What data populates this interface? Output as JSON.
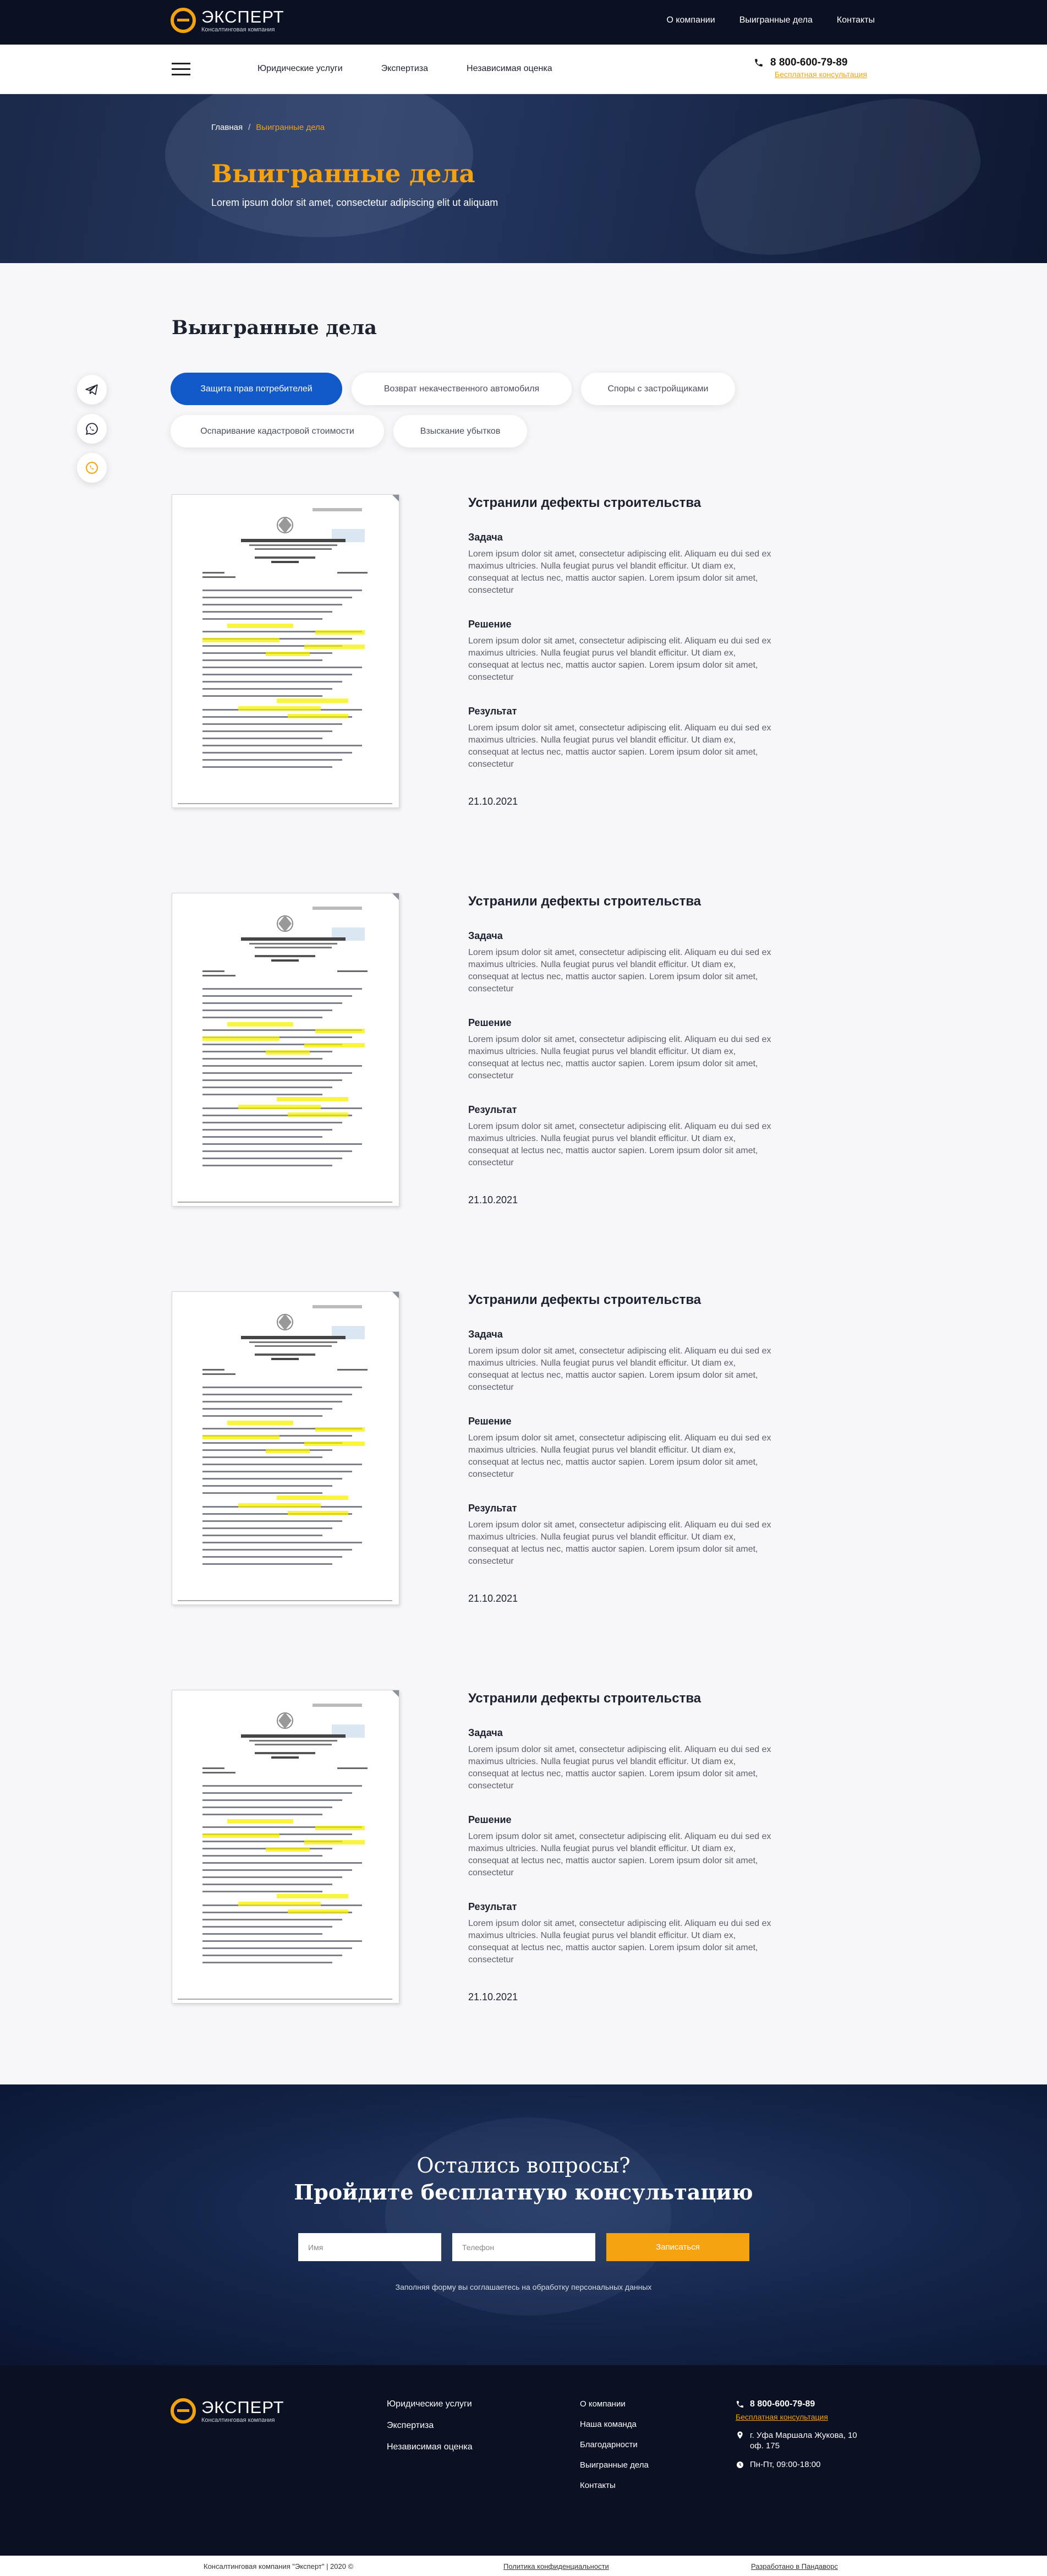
{
  "topbar": {
    "logo_title": "ЭКСПЕРТ",
    "logo_sub": "Консалтинговая компания",
    "nav": [
      "О компании",
      "Выигранные дела",
      "Контакты"
    ]
  },
  "navbar": {
    "menu": [
      "Юридические услуги",
      "Экспертиза",
      "Независимая оценка"
    ],
    "phone": "8 800-600-79-89",
    "consult": "Бесплатная консультация"
  },
  "hero": {
    "crumb_home": "Главная",
    "crumb_sep": "/",
    "crumb_current": "Выигранные дела",
    "title": "Выигранные дела",
    "subtitle": "Lorem ipsum dolor sit amet, consectetur adipiscing elit ut aliquam"
  },
  "section": {
    "title": "Выигранные дела",
    "tabs": [
      "Защита прав потребителей",
      "Возврат некачественного автомобиля",
      "Споры с застройщиками",
      "Оспаривание кадастровой стоимости",
      "Взыскание убытков"
    ],
    "active_tab": "Защита прав потребителей"
  },
  "social": [
    "telegram-icon",
    "whatsapp-icon",
    "viber-icon"
  ],
  "cases": [
    {
      "title": "Устранили дефекты строительства",
      "task_h": "Задача",
      "task": "Lorem ipsum dolor sit amet, consectetur adipiscing elit. Aliquam eu dui sed ex maximus ultricies. Nulla feugiat purus vel blandit efficitur. Ut diam ex, consequat at lectus nec, mattis auctor sapien. Lorem ipsum dolor sit amet, consectetur",
      "solution_h": "Решение",
      "solution": "Lorem ipsum dolor sit amet, consectetur adipiscing elit. Aliquam eu dui sed ex maximus ultricies. Nulla feugiat purus vel blandit efficitur. Ut diam ex, consequat at lectus nec, mattis auctor sapien. Lorem ipsum dolor sit amet, consectetur",
      "result_h": "Результат",
      "result": "Lorem ipsum dolor sit amet, consectetur adipiscing elit. Aliquam eu dui sed ex maximus ultricies. Nulla feugiat purus vel blandit efficitur. Ut diam ex, consequat at lectus nec, mattis auctor sapien. Lorem ipsum dolor sit amet, consectetur",
      "date": "21.10.2021"
    },
    {
      "title": "Устранили дефекты строительства",
      "task_h": "Задача",
      "task": "Lorem ipsum dolor sit amet, consectetur adipiscing elit. Aliquam eu dui sed ex maximus ultricies. Nulla feugiat purus vel blandit efficitur. Ut diam ex, consequat at lectus nec, mattis auctor sapien. Lorem ipsum dolor sit amet, consectetur",
      "solution_h": "Решение",
      "solution": "Lorem ipsum dolor sit amet, consectetur adipiscing elit. Aliquam eu dui sed ex maximus ultricies. Nulla feugiat purus vel blandit efficitur. Ut diam ex, consequat at lectus nec, mattis auctor sapien. Lorem ipsum dolor sit amet, consectetur",
      "result_h": "Результат",
      "result": "Lorem ipsum dolor sit amet, consectetur adipiscing elit. Aliquam eu dui sed ex maximus ultricies. Nulla feugiat purus vel blandit efficitur. Ut diam ex, consequat at lectus nec, mattis auctor sapien. Lorem ipsum dolor sit amet, consectetur",
      "date": "21.10.2021"
    },
    {
      "title": "Устранили дефекты строительства",
      "task_h": "Задача",
      "task": "Lorem ipsum dolor sit amet, consectetur adipiscing elit. Aliquam eu dui sed ex maximus ultricies. Nulla feugiat purus vel blandit efficitur. Ut diam ex, consequat at lectus nec, mattis auctor sapien. Lorem ipsum dolor sit amet, consectetur",
      "solution_h": "Решение",
      "solution": "Lorem ipsum dolor sit amet, consectetur adipiscing elit. Aliquam eu dui sed ex maximus ultricies. Nulla feugiat purus vel blandit efficitur. Ut diam ex, consequat at lectus nec, mattis auctor sapien. Lorem ipsum dolor sit amet, consectetur",
      "result_h": "Результат",
      "result": "Lorem ipsum dolor sit amet, consectetur adipiscing elit. Aliquam eu dui sed ex maximus ultricies. Nulla feugiat purus vel blandit efficitur. Ut diam ex, consequat at lectus nec, mattis auctor sapien. Lorem ipsum dolor sit amet, consectetur",
      "date": "21.10.2021"
    },
    {
      "title": "Устранили дефекты строительства",
      "task_h": "Задача",
      "task": "Lorem ipsum dolor sit amet, consectetur adipiscing elit. Aliquam eu dui sed ex maximus ultricies. Nulla feugiat purus vel blandit efficitur. Ut diam ex, consequat at lectus nec, mattis auctor sapien. Lorem ipsum dolor sit amet, consectetur",
      "solution_h": "Решение",
      "solution": "Lorem ipsum dolor sit amet, consectetur adipiscing elit. Aliquam eu dui sed ex maximus ultricies. Nulla feugiat purus vel blandit efficitur. Ut diam ex, consequat at lectus nec, mattis auctor sapien. Lorem ipsum dolor sit amet, consectetur",
      "result_h": "Результат",
      "result": "Lorem ipsum dolor sit amet, consectetur adipiscing elit. Aliquam eu dui sed ex maximus ultricies. Nulla feugiat purus vel blandit efficitur. Ut diam ex, consequat at lectus nec, mattis auctor sapien. Lorem ipsum dolor sit amet, consectetur",
      "date": "21.10.2021"
    }
  ],
  "cta": {
    "line1": "Остались вопросы?",
    "line2": "Пройдите бесплатную консультацию",
    "name_placeholder": "Имя",
    "phone_placeholder": "Телефон",
    "button": "Записаться",
    "note": "Заполняя форму вы соглашаетесь на обработку персональных данных"
  },
  "footer": {
    "logo_title": "ЭКСПЕРТ",
    "logo_sub": "Консалтинговая компания",
    "col1": [
      "Юридические услуги",
      "Экспертиза",
      "Независимая оценка"
    ],
    "col2": [
      "О компании",
      "Наша команда",
      "Благодарности",
      "Выигранные дела",
      "Контакты"
    ],
    "phone": "8 800-600-79-89",
    "consult": "Бесплатная консультация",
    "address": "г. Уфа Маршала Жукова, 10 оф. 175",
    "hours": "Пн-Пт, 09:00-18:00",
    "copyright": "Консалтинговая компания \"Эксперт\" | 2020 ©",
    "privacy": "Политика конфиденциальности",
    "dev": "Разработано в Пандаворс"
  },
  "colors": {
    "accent": "#f4a20f",
    "active_tab": "#1159c9",
    "dark": "#0b1022"
  }
}
